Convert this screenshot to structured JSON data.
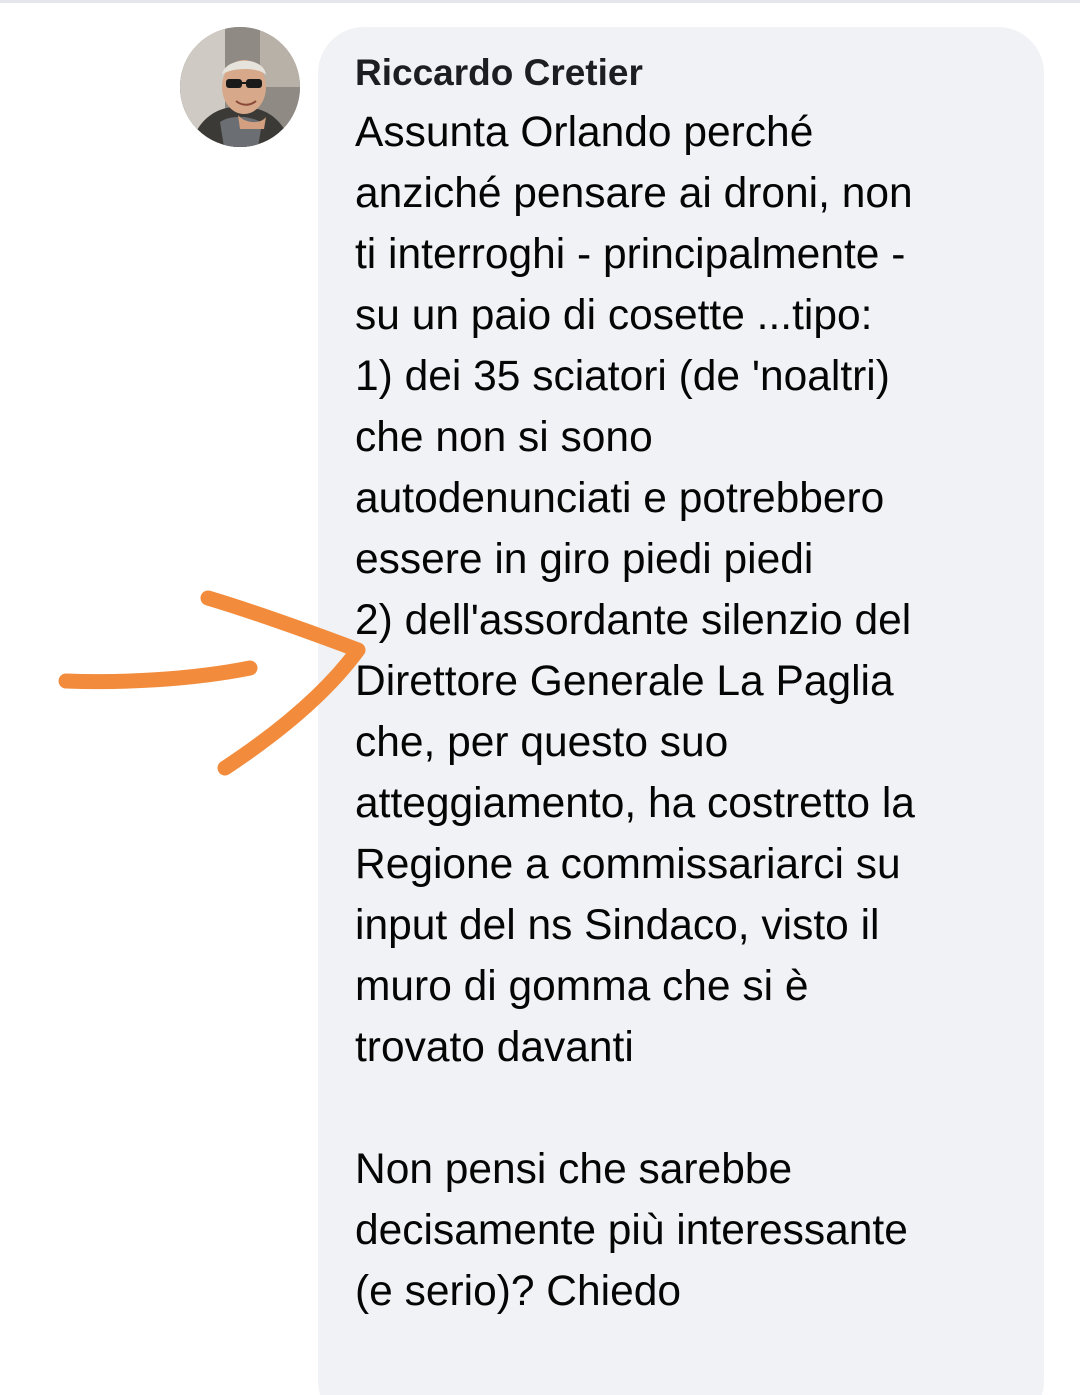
{
  "comment": {
    "author": "Riccardo Cretier",
    "lines": [
      "Assunta Orlando perché",
      "anziché pensare ai droni, non",
      "ti interroghi - principalmente -",
      "su un paio di cosette ...tipo:",
      "1) dei 35 sciatori (de 'noaltri)",
      "che non si sono",
      "autodenunciati e potrebbero",
      "essere in giro piedi piedi",
      "2) dell'assordante silenzio del",
      "Direttore Generale La Paglia",
      "che, per questo suo",
      "atteggiamento, ha costretto la",
      "Regione a commissariarci su",
      "input del ns Sindaco, visto il",
      "muro di gomma che si è",
      "trovato davanti",
      "",
      "Non pensi che sarebbe",
      "decisamente più interessante",
      "(e serio)? Chiedo"
    ]
  },
  "colors": {
    "bubble_bg": "#f0f2f5",
    "text": "#050505",
    "author_text": "#1c1e21",
    "annotation_arrow": "#f28c3c"
  },
  "icons": {
    "avatar": "profile-photo",
    "annotation": "hand-drawn-arrow"
  }
}
